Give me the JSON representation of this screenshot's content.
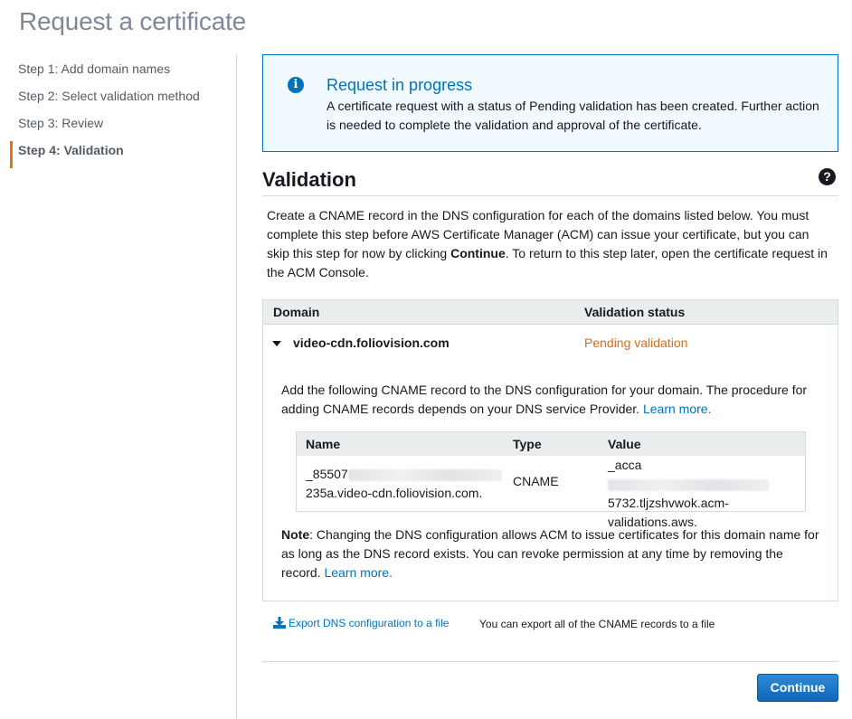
{
  "page": {
    "title": "Request a certificate"
  },
  "steps": [
    {
      "label": "Step 1: Add domain names"
    },
    {
      "label": "Step 2: Select validation method"
    },
    {
      "label": "Step 3: Review"
    },
    {
      "label": "Step 4: Validation",
      "active": true
    }
  ],
  "info": {
    "icon": "info-icon",
    "title": "Request in progress",
    "text": "A certificate request with a status of Pending validation has been created. Further action is needed to complete the validation and approval of the certificate."
  },
  "validation": {
    "title": "Validation",
    "help_icon": "question-circle-icon",
    "desc_part1": "Create a CNAME record in the DNS configuration for each of the domains listed below. You must complete this step before AWS Certificate Manager (ACM) can issue your certificate, but you can skip this step for now by clicking ",
    "desc_bold": "Continue",
    "desc_part2": ". To return to this step later, open the certificate request in the ACM Console."
  },
  "table": {
    "col_domain": "Domain",
    "col_status": "Validation status",
    "row": {
      "domain": "video-cdn.foliovision.com",
      "status": "Pending validation",
      "status_color": "#dd6b10"
    },
    "detail_text": "Add the following CNAME record to the DNS configuration for your domain. The procedure for adding CNAME records depends on your DNS service Provider. ",
    "detail_link": "Learn more.",
    "cname": {
      "col_name": "Name",
      "col_type": "Type",
      "col_value": "Value",
      "name_prefix": "_85507",
      "name_suffix": "235a.video-cdn.foliovision.com.",
      "type": "CNAME",
      "value_prefix": "_acca",
      "value_suffix": "5732.tljzshvwok.acm-validations.aws."
    },
    "note_bold": "Note",
    "note_text": ": Changing the DNS configuration allows ACM to issue certificates for this domain name for as long as the DNS record exists. You can revoke permission at any time by removing the record. ",
    "note_link": "Learn more."
  },
  "export": {
    "icon": "download-icon",
    "label": "Export DNS configuration to a file",
    "note": "You can export all of the CNAME records to a file"
  },
  "footer": {
    "continue_label": "Continue"
  },
  "colors": {
    "accent": "#0073bb",
    "step_marker": "#ec7211",
    "pending": "#dd6b10"
  }
}
